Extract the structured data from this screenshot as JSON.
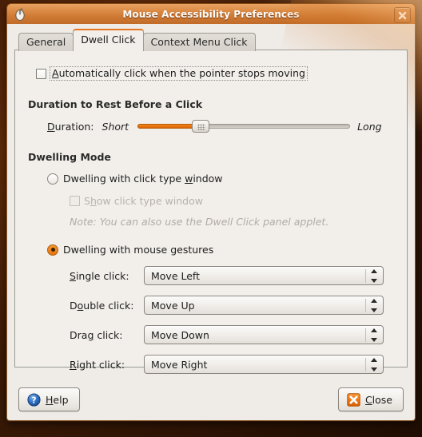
{
  "window": {
    "title": "Mouse Accessibility Preferences",
    "icon": "mouse-icon",
    "close_icon": "window-close-icon"
  },
  "tabs": [
    {
      "label": "General",
      "active": false
    },
    {
      "label": "Dwell Click",
      "active": true
    },
    {
      "label": "Context Menu Click",
      "active": false
    }
  ],
  "dwell": {
    "auto_click": {
      "label_pre": "A",
      "label_post": "utomatically click when the pointer stops moving",
      "checked": false
    },
    "duration_section": {
      "heading": "Duration to Rest Before a Click",
      "label_pre": "D",
      "label_post": "uration:",
      "min_label": "Short",
      "max_label": "Long",
      "value_percent": 28
    },
    "mode_section": {
      "heading": "Dwelling Mode",
      "option_window": {
        "label_a": "Dwelling with click type ",
        "label_mn": "w",
        "label_b": "indow",
        "selected": false
      },
      "show_window": {
        "label_a": "S",
        "label_mn": "h",
        "label_b": "ow click type window",
        "checked": false,
        "enabled": false
      },
      "note": "Note: You can also use the Dwell Click panel applet.",
      "option_gestures": {
        "label": "Dwelling with mouse gestures",
        "selected": true
      }
    },
    "gestures": [
      {
        "label_mn": "S",
        "label_rest": "ingle click:",
        "value": "Move Left"
      },
      {
        "label_pre": "D",
        "label_mn": "o",
        "label_rest": "uble click:",
        "value": "Move Up"
      },
      {
        "label_pre": "Dra",
        "label_mn": "g",
        "label_rest": " click:",
        "value": "Move Down"
      },
      {
        "label_mn": "R",
        "label_rest": "ight click:",
        "value": "Move Right"
      }
    ]
  },
  "buttons": {
    "help": {
      "label_mn": "H",
      "label_rest": "elp",
      "icon": "help-icon"
    },
    "close": {
      "label_mn": "C",
      "label_rest": "lose",
      "icon": "close-x-icon"
    }
  },
  "colors": {
    "accent_orange": "#e8741d",
    "titlebar_orange": "#cf7a34",
    "panel_bg": "#f2efeb",
    "window_bg": "#efebe7",
    "disabled_text": "#b6b1aa"
  }
}
